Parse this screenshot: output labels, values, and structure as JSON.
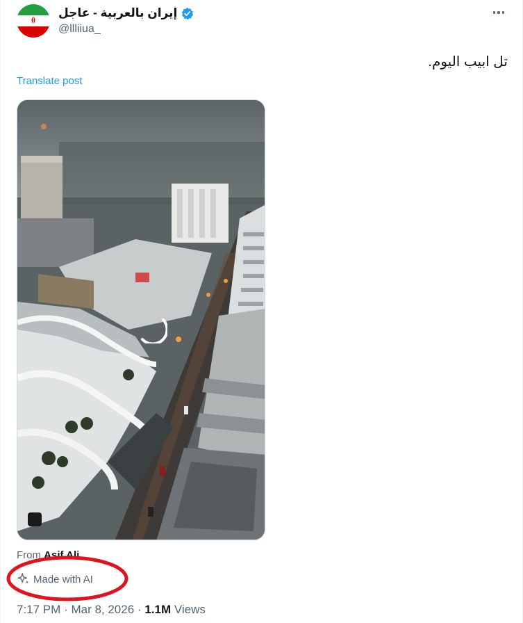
{
  "author": {
    "display_name": "إيران بالعربية - عاجل",
    "handle": "@llliiua_",
    "verified_icon": "verified-badge-icon",
    "avatar_icon": "iran-flag-avatar"
  },
  "more_icon": "more-icon",
  "post": {
    "text": "تل ابيب اليوم.",
    "translate_label": "Translate post"
  },
  "media": {
    "type": "video",
    "loading_icon": "loading-spinner-icon"
  },
  "attribution": {
    "prefix": "From",
    "name": "Asif Ali"
  },
  "ai_label": {
    "icon": "sparkle-icon",
    "text": "Made with AI"
  },
  "meta": {
    "time": "7:17 PM",
    "separator": "·",
    "date": "Mar 8, 2026",
    "views_count": "1.1M",
    "views_label": "Views"
  },
  "colors": {
    "link": "#1d9bf0",
    "secondary_text": "#536471",
    "annotation": "#e0141e"
  }
}
